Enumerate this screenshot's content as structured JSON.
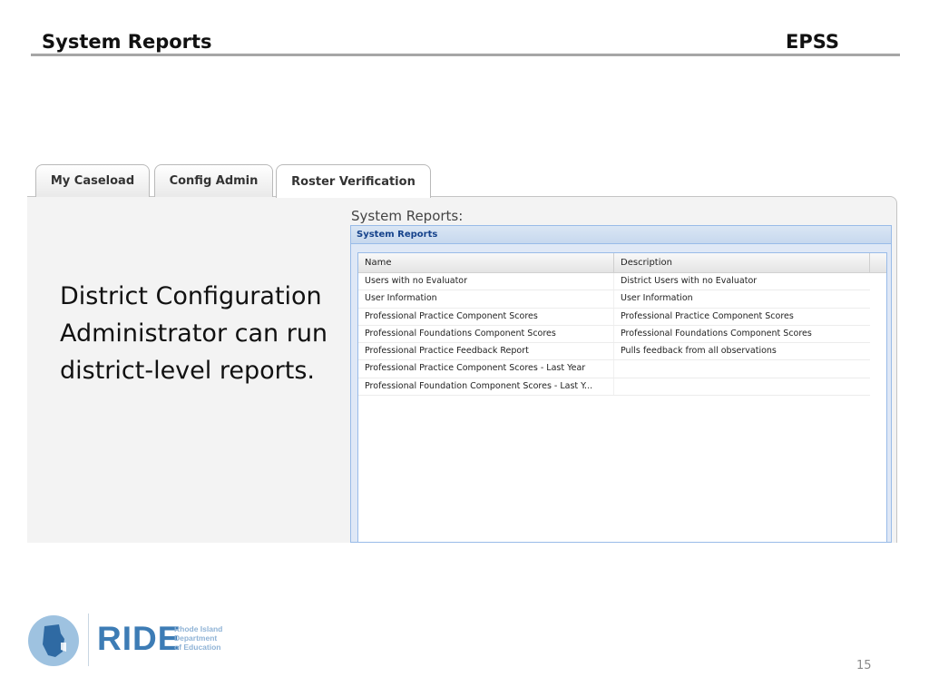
{
  "slide": {
    "title": "System Reports",
    "tag": "EPSS",
    "callout": "District Configuration Administrator can run district-level reports.",
    "page_number": "15"
  },
  "tabs": [
    {
      "label": "My Caseload",
      "active": false
    },
    {
      "label": "Config Admin",
      "active": false
    },
    {
      "label": "Roster Verification",
      "active": true
    }
  ],
  "reports": {
    "section_label": "System Reports:",
    "panel_title": "System Reports",
    "columns": {
      "name": "Name",
      "description": "Description"
    },
    "rows": [
      {
        "name": "Users with no Evaluator",
        "description": "District Users with no Evaluator"
      },
      {
        "name": "User Information",
        "description": "User Information"
      },
      {
        "name": "Professional Practice Component Scores",
        "description": "Professional Practice Component Scores"
      },
      {
        "name": "Professional Foundations Component Scores",
        "description": "Professional Foundations Component Scores"
      },
      {
        "name": "Professional Practice Feedback Report",
        "description": "Pulls feedback from all observations"
      },
      {
        "name": "Professional Practice Component Scores - Last Year",
        "description": ""
      },
      {
        "name": "Professional Foundation Component Scores - Last Y...",
        "description": ""
      }
    ]
  },
  "logo": {
    "wordmark": "RIDE",
    "subtitle_lines": [
      "Rhode Island",
      "Department",
      "of Education"
    ],
    "color": "#3d7cb5"
  }
}
